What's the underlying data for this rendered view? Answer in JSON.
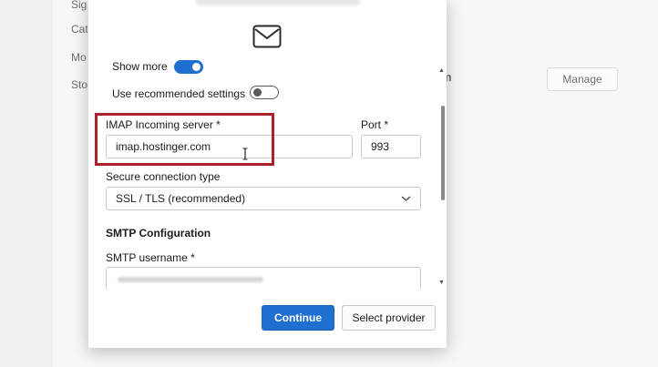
{
  "background": {
    "nav_items": [
      "Sig",
      "Cat",
      "Mo",
      "Sto"
    ],
    "right_label": "m",
    "manage_button": "Manage"
  },
  "dialog": {
    "show_more_label": "Show more",
    "recommended_label": "Use recommended settings",
    "imap_server_label": "IMAP Incoming server *",
    "imap_server_value": "imap.hostinger.com",
    "port_label": "Port *",
    "port_value": "993",
    "secure_label": "Secure connection type",
    "secure_value": "SSL / TLS (recommended)",
    "smtp_section": "SMTP Configuration",
    "smtp_username_label": "SMTP username *",
    "continue_button": "Continue",
    "select_provider_button": "Select provider"
  },
  "icons": {
    "mail": "mail-icon",
    "chevron": "chevron-down-icon",
    "cursor": "text-cursor-icon"
  },
  "colors": {
    "accent": "#1f6fd1",
    "highlight": "#b0202a"
  },
  "toggles": {
    "show_more": true,
    "recommended": false
  }
}
